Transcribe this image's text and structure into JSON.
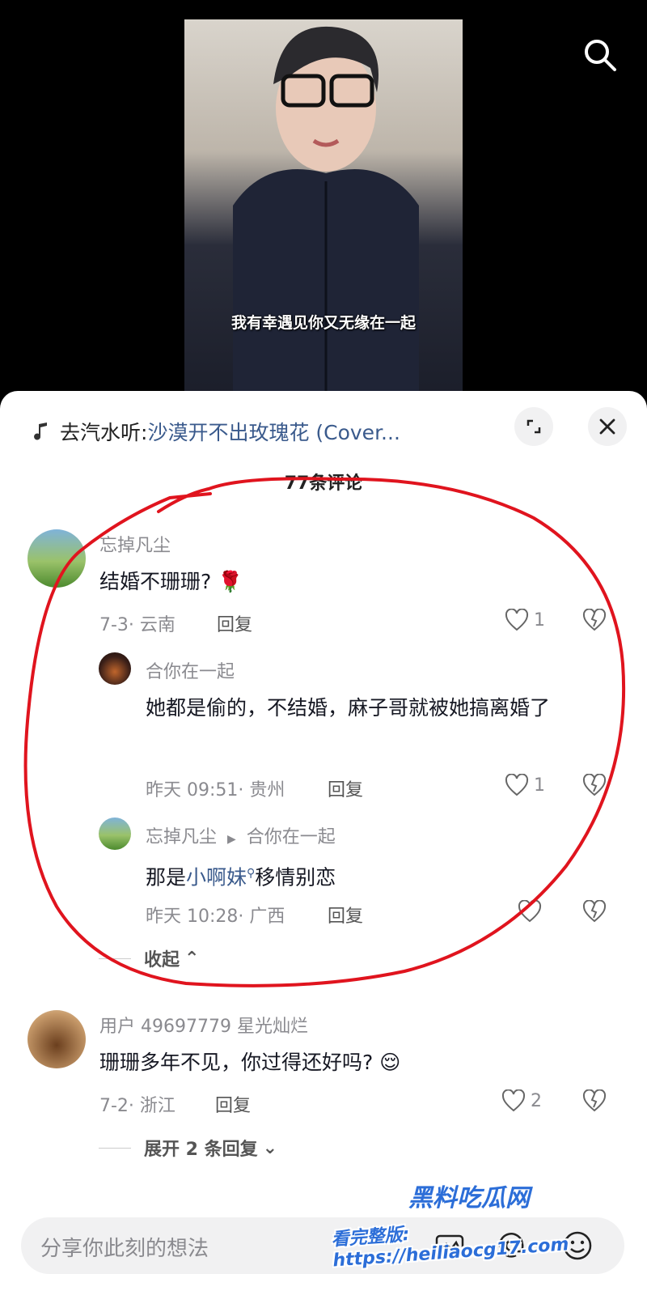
{
  "video": {
    "subtitle": "我有幸遇见你又无缘在一起"
  },
  "music": {
    "prefix": "去汽水听: ",
    "song": "沙漠开不出玫瑰花 (Cover..."
  },
  "comments_header": {
    "count": "77条评论"
  },
  "comments": [
    {
      "user": "忘掉凡尘",
      "text": "结婚不珊珊?",
      "emoji": "🌹",
      "meta": "7-3· 云南",
      "reply": "回复",
      "likes": "1",
      "replies": [
        {
          "user": "合你在一起",
          "text": "她都是偷的，不结婚，麻子哥就被她搞离婚了",
          "meta": "昨天 09:51· 贵州",
          "reply": "回复",
          "likes": "1"
        },
        {
          "user": "忘掉凡尘",
          "reply_to": "合你在一起",
          "text_before": "那是",
          "text_link": "小啊妹",
          "text_after": "移情别恋",
          "meta": "昨天 10:28· 广西",
          "reply": "回复"
        }
      ],
      "collapse": "收起"
    },
    {
      "user": "用户 49697779 星光灿烂",
      "text": "珊珊多年不见，你过得还好吗?",
      "emoji": "😌",
      "meta": "7-2· 浙江",
      "reply": "回复",
      "likes": "2",
      "expand": "展开 2 条回复"
    }
  ],
  "input": {
    "placeholder": "分享你此刻的想法"
  },
  "watermark": {
    "line1": "黑料吃瓜网",
    "line2": "看完整版: https://heiliaocg17.com"
  },
  "colors": {
    "link": "#3a5a8c",
    "annotation": "#e0141e"
  }
}
